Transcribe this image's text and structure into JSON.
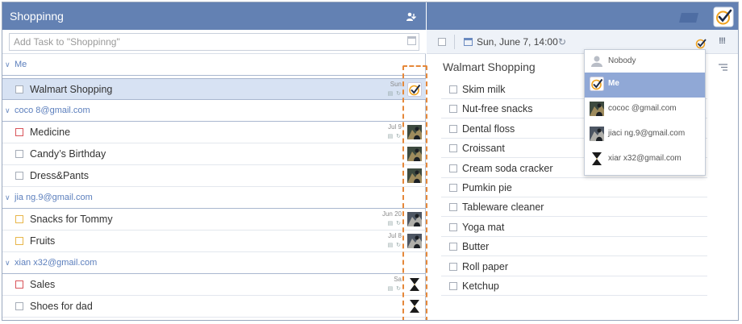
{
  "list": {
    "title": "Shoppinng",
    "add_placeholder": "Add Task to \"Shoppinng\"",
    "groups": [
      {
        "label": "Me",
        "tasks": [
          {
            "name": "Walmart Shopping",
            "date": "Sun",
            "selected": true,
            "priority": "none",
            "assignee": "me"
          }
        ]
      },
      {
        "label": "coco        8@gmail.com",
        "tasks": [
          {
            "name": "Medicine",
            "date": "Jul 9",
            "priority": "high",
            "assignee": "coco"
          },
          {
            "name": "Candy’s Birthday",
            "date": "",
            "priority": "none",
            "assignee": "coco"
          },
          {
            "name": "Dress&Pants",
            "date": "",
            "priority": "none",
            "assignee": "coco"
          }
        ]
      },
      {
        "label": "jia          ng.9@gmail.com",
        "tasks": [
          {
            "name": "Snacks for Tommy",
            "date": "Jun 20",
            "priority": "medium",
            "assignee": "jia"
          },
          {
            "name": "Fruits",
            "date": "Jul 8",
            "priority": "medium",
            "assignee": "jia"
          }
        ]
      },
      {
        "label": "xian        x32@gmail.com",
        "tasks": [
          {
            "name": "Sales",
            "date": "Sa",
            "priority": "high",
            "assignee": "xian"
          },
          {
            "name": "Shoes for dad",
            "date": "",
            "priority": "none",
            "assignee": "xian"
          }
        ]
      }
    ]
  },
  "detail": {
    "due": "Sun,  June 7, 14:00",
    "priority_icon": "!!!",
    "title": "Walmart Shopping",
    "subtasks": [
      "Skim milk",
      "Nut-free snacks",
      "Dental floss",
      "Croissant",
      "Cream soda cracker",
      "Pumkin pie",
      "Tableware cleaner",
      "Yoga mat",
      "Butter",
      "Roll paper",
      "Ketchup"
    ]
  },
  "assign_menu": {
    "items": [
      {
        "label": "Nobody",
        "avatar": "nobody",
        "active": false
      },
      {
        "label": "Me",
        "avatar": "me",
        "active": true
      },
      {
        "label": "cococ          @gmail.com",
        "avatar": "coco",
        "active": false
      },
      {
        "label": "jiaci          ng.9@gmail.com",
        "avatar": "jia",
        "active": false
      },
      {
        "label": "xiar          x32@gmail.com",
        "avatar": "xian",
        "active": false
      }
    ]
  },
  "colors": {
    "header": "#6381b3",
    "selected_row": "#d7e2f3",
    "priority_high": "#d9545a",
    "priority_medium": "#e8b64a",
    "highlight": "#e5883a"
  },
  "icons": [
    "share-icon",
    "calendar-icon",
    "repeat-icon",
    "check-logo-icon",
    "priority-icon",
    "notes-icon",
    "chevron-down-icon"
  ]
}
